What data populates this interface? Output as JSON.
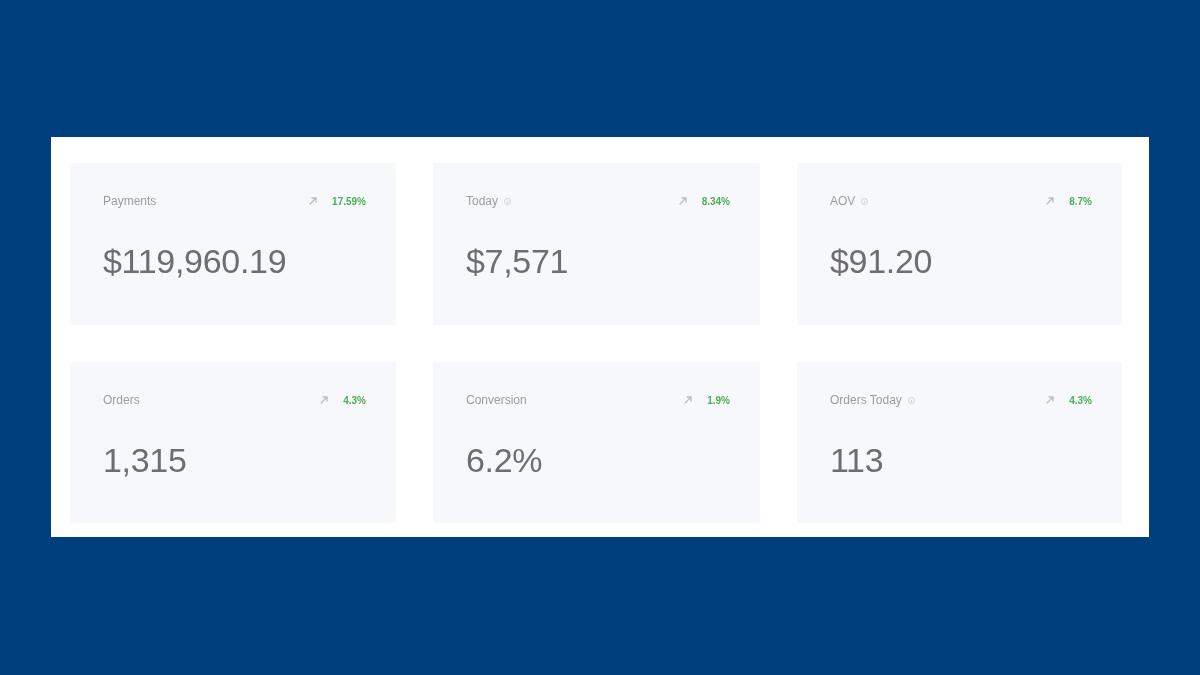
{
  "cards": [
    {
      "label": "Payments",
      "info": false,
      "change": "17.59%",
      "value": "$119,960.19"
    },
    {
      "label": "Today",
      "info": true,
      "change": "8.34%",
      "value": "$7,571"
    },
    {
      "label": "AOV",
      "info": true,
      "change": "8.7%",
      "value": "$91.20"
    },
    {
      "label": "Orders",
      "info": false,
      "change": "4.3%",
      "value": "1,315"
    },
    {
      "label": "Conversion",
      "info": false,
      "change": "1.9%",
      "value": "6.2%"
    },
    {
      "label": "Orders Today",
      "info": true,
      "change": "4.3%",
      "value": "113"
    }
  ]
}
